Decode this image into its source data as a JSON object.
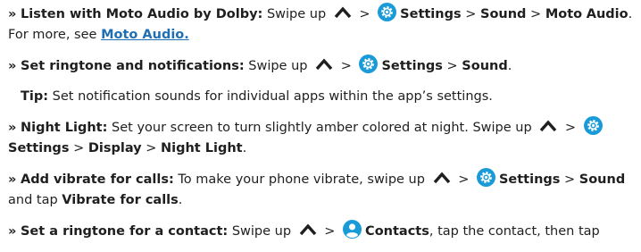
{
  "bullet": "»",
  "gt": ">",
  "icons": {
    "up": "caret-up-icon",
    "settings": "settings-gear-icon",
    "contacts": "contacts-person-icon",
    "accent": "#1a9bd7"
  },
  "items": [
    {
      "title": "Listen with Moto Audio by Dolby:",
      "swipe": "Swipe up",
      "s1": "Settings",
      "s2": "Sound",
      "s3": "Moto",
      "s4": "Audio",
      "more": ". For more, see",
      "link": "Moto Audio."
    },
    {
      "title": "Set ringtone and notifications:",
      "swipe": "Swipe up",
      "s1": "Settings",
      "s2": "Sound",
      "end": "."
    },
    {
      "tip_label": "Tip:",
      "tip_text": "Set notification sounds for individual apps within the app’s settings."
    },
    {
      "title": "Night Light:",
      "text": "Set your screen to turn slightly amber colored at night. Swipe up",
      "s1": "Settings",
      "s2": "Display",
      "s3": "Night Light",
      "end": "."
    },
    {
      "title": "Add vibrate for calls:",
      "text": "To make your phone vibrate, swipe up",
      "s1": "Settings",
      "s2": "Sound",
      "and_tap": "and tap",
      "s3": "Vibrate for calls",
      "end": "."
    },
    {
      "title": "Set a ringtone for a contact:",
      "swipe": "Swipe up",
      "s1": "Contacts",
      "rest": ", tap the contact, then tap"
    }
  ]
}
